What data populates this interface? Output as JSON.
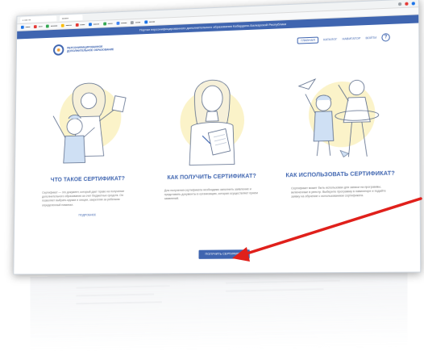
{
  "browser": {
    "tabs": [
      "•  ••• ••",
      "••••••"
    ],
    "bookmarks": [
      {
        "label": "•••••",
        "color": "#1a73e8"
      },
      {
        "label": "••••",
        "color": "#e53935"
      },
      {
        "label": "•••••••",
        "color": "#34a853"
      },
      {
        "label": "••••••",
        "color": "#fbbc05"
      },
      {
        "label": "•••••",
        "color": "#e53935"
      },
      {
        "label": "••••••",
        "color": "#1a73e8"
      },
      {
        "label": "•••••",
        "color": "#34a853"
      },
      {
        "label": "••••••",
        "color": "#4285f4"
      },
      {
        "label": "•••••",
        "color": "#9aa0a6"
      },
      {
        "label": "••••••",
        "color": "#1a73e8"
      }
    ]
  },
  "site": {
    "banner": "Портал персонифицированного дополнительного образования Кабардино-Балкарской Республики",
    "logo_text": "ПЕРСОНИФИЦИРОВАННОЕ ДОПОЛНИТЕЛЬНОЕ ОБРАЗОВАНИЕ",
    "nav": [
      "ГЛАВНАЯ",
      "КАТАЛОГ",
      "НАВИГАТОР",
      "ВОЙТИ"
    ],
    "help_label": "?",
    "columns": [
      {
        "title": "ЧТО ТАКОЕ СЕРТИФИКАТ?",
        "text": "Сертификат — это документ, который дает право на получение дополнительного образования за счет бюджетных средств. Он позволяет выбрать кружки и секции, закрепляя за ребенком определенный номинал.",
        "link": "ПОДРОБНЕЕ"
      },
      {
        "title": "КАК ПОЛУЧИТЬ СЕРТИФИКАТ?",
        "text": "Для получения сертификата необходимо заполнить заявление и представить документы в организацию, которая осуществляет прием заявлений.",
        "link": ""
      },
      {
        "title": "КАК ИСПОЛЬЗОВАТЬ СЕРТИФИКАТ?",
        "text": "Сертификат может быть использован для записи на программы, включенные в реестр. Выберите программу в навигаторе и подайте заявку на обучение с использованием сертификата.",
        "link": ""
      }
    ],
    "cta": "ПОЛУЧИТЬ СЕРТИФИКАТ"
  },
  "annotation": {
    "color": "#e0201b"
  }
}
